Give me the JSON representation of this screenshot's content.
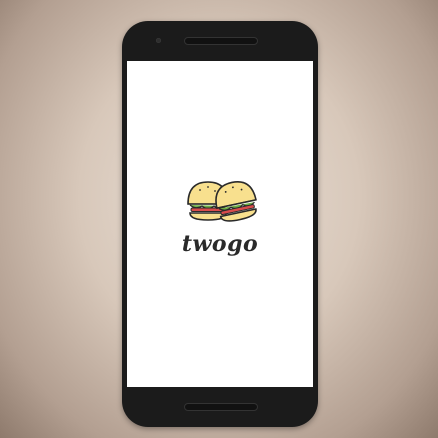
{
  "app": {
    "name": "twogo",
    "logo_icon": "burger-pair-icon"
  },
  "device": {
    "frame": "android-phone"
  }
}
